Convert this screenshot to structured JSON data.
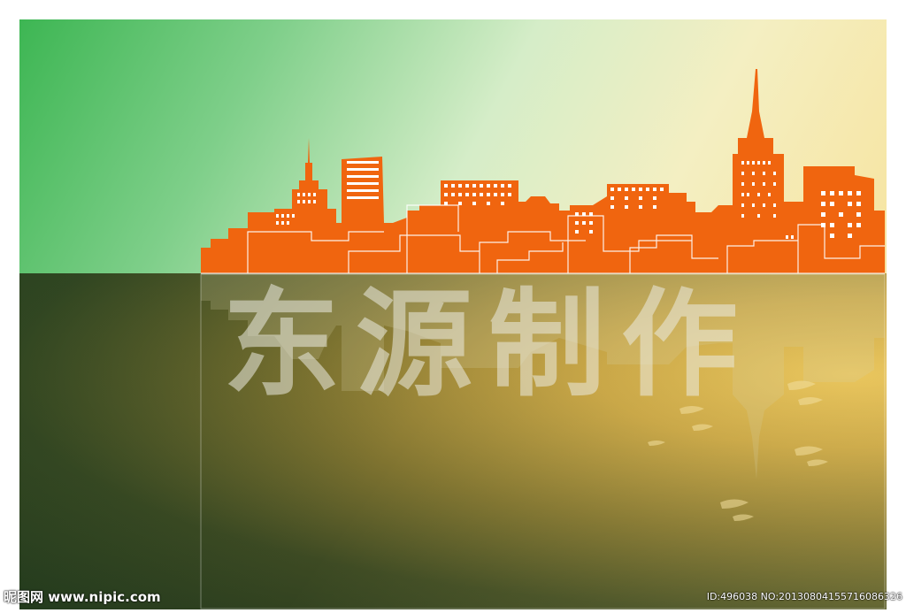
{
  "image": {
    "watermark_text": "东源制作",
    "footer_left": "昵图网 www.nipic.com",
    "footer_right": "ID:496038 NO:20130804155716086326",
    "colors": {
      "sky_green": "#3db653",
      "sky_cream": "#f4efc2",
      "skyline_orange": "#f0650f",
      "water_dark": "#263a1d",
      "water_gold": "#e7c35a"
    }
  }
}
